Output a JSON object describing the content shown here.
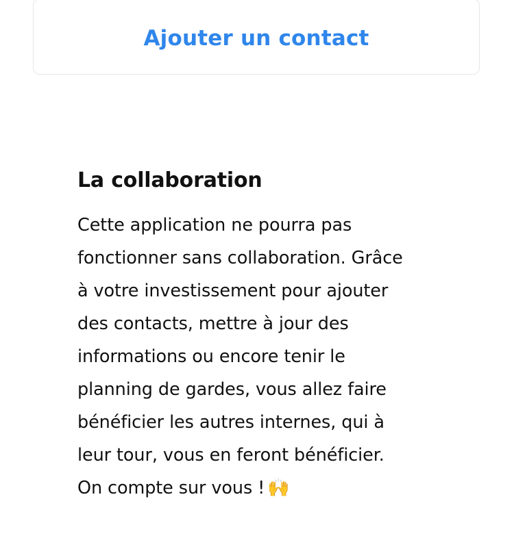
{
  "actions": {
    "add_contact_label": "Ajouter un contact"
  },
  "collaboration": {
    "title": "La collaboration",
    "lines": [
      "Cette application ne pourra pas",
      "fonctionner sans collaboration. Grâce",
      "à votre investissement pour ajouter",
      "des contacts, mettre à jour des",
      "informations ou encore tenir le",
      "planning de gardes, vous allez faire",
      "bénéficier les autres internes, qui à",
      "leur tour, vous en feront bénéficier.",
      "On compte sur vous !"
    ],
    "emoji": "🙌"
  },
  "colors": {
    "accent": "#2f86eb",
    "text": "#111111",
    "border": "#e6e6ea"
  }
}
